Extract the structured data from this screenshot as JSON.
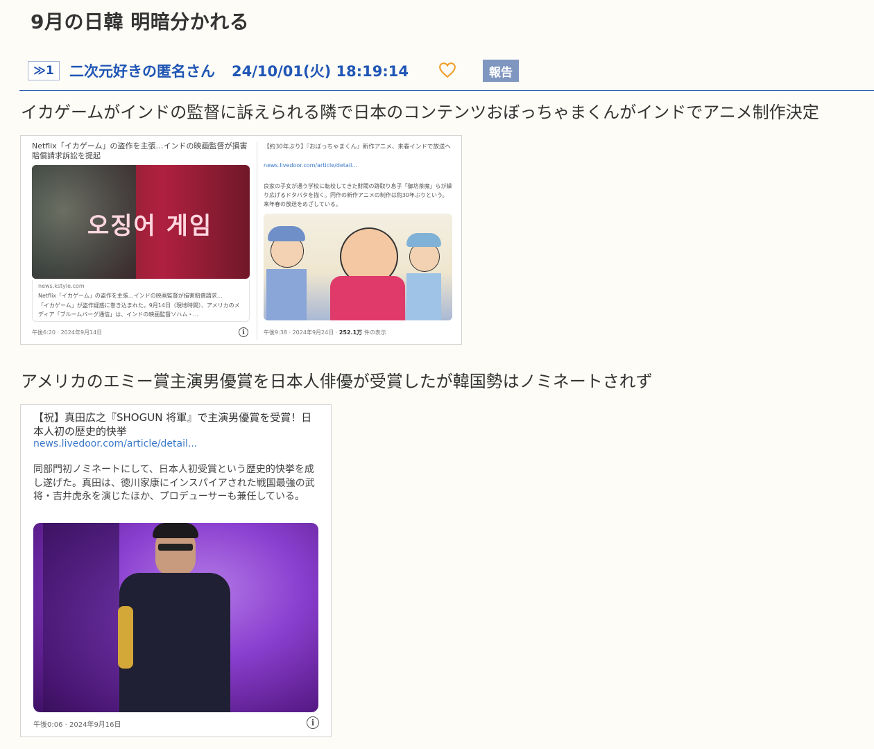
{
  "thread": {
    "title": "9月の日韓 明暗分かれる"
  },
  "post": {
    "number": "≫1",
    "author": "二次元好きの匿名さん",
    "datetime": "24/10/01(火) 18:19:14",
    "report_label": "報告",
    "paragraph1": "イカゲームがインドの監督に訴えられる隣で日本のコンテンツおぼっちゃまくんがインドでアニメ制作決定",
    "paragraph2": "アメリカのエミー賞主演男優賞を日本人俳優が受賞したが韓国勢はノミネートされず"
  },
  "embed1": {
    "left": {
      "headline": "Netflix「イカゲーム」の盗作を主張…インドの映画監督が損害賠償請求訴訟を提起",
      "image_text": "오징어 게임",
      "source": "news.kstyle.com",
      "card_title": "Netflix「イカゲーム」の盗作を主張…インドの映画監督が損害賠償請求…",
      "card_snippet": "「イカゲーム」が盗作疑惑に巻き込まれた。9月14日（現地時間）、アメリカのメディア「ブルームバーグ通信」は、インドの映画監督ソハム・…",
      "timestamp": "午後6:20 · 2024年9月14日"
    },
    "right": {
      "headline": "【約30年ぶり】『おぼっちゃまくん』新作アニメ、来春インドで放送へ",
      "link": "news.livedoor.com/article/detail...",
      "snippet": "良家の子女が通う学校に転校してきた財閥の跡取り息子「御坊茶魔」らが繰り広げるドタバタを描く。同作の新作アニメの制作は約30年ぶりという。来年春の放送をめざしている。",
      "timestamp": "午後9:38 · 2024年9月24日 ·",
      "views_count": "252.1万",
      "views_label": "件の表示"
    }
  },
  "embed2": {
    "headline": "【祝】真田広之『SHOGUN 将軍』で主演男優賞を受賞！日本人初の歴史的快挙",
    "link": "news.livedoor.com/article/detail...",
    "snippet": "同部門初ノミネートにして、日本人初受賞という歴史的快挙を成し遂げた。真田は、徳川家康にインスパイアされた戦国最強の武将・吉井虎永を演じたほか、プロデューサーも兼任している。",
    "timestamp": "午後0:06 · 2024年9月16日"
  },
  "colors": {
    "link_blue": "#1f55b5",
    "report_bg": "#7f96c0",
    "heart": "#f0a030",
    "page_bg": "#fdfcf6"
  },
  "icons": {
    "like": "heart-outline-icon",
    "info": "info-circle-icon"
  }
}
